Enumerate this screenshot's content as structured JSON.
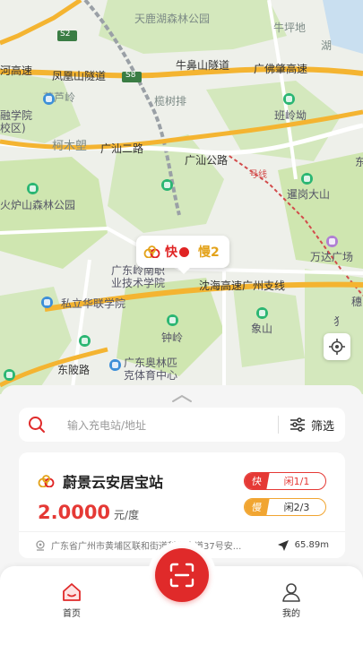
{
  "map": {
    "labels": {
      "park_top": "天鹿湖森林公园",
      "niupingdi": "牛坪地",
      "hu": "湖",
      "s2": "S2",
      "s8": "S8",
      "he_gaosu": "河高速",
      "fengfengshan": "凤凰山隧道",
      "niubishan": "牛鼻山隧道",
      "guangfozhao": "广佛肇高速",
      "huluyan": "葫芦岭",
      "rong_xueyuan": "融学院",
      "xiaoqu": "校区)",
      "mushuping": "榄树排",
      "banling": "班岭坳",
      "kemushi": "柯木塱",
      "guangshan2": "广汕二路",
      "guangshan": "广汕公路",
      "hao_xian": "号线",
      "yuan_east": "东",
      "huolushan": "火炉山森林公园",
      "xianggang": "暹岗大山",
      "wanda": "万达广场",
      "guangdong_lingnan": "广东岭南职",
      "ye_jishu": "业技术学院",
      "shenhai": "沈海高速广州支线",
      "sili_huakuang": "私立华联学院",
      "zhongling": "钟岭",
      "xiangshan": "象山",
      "dongling_lu": "东陂路",
      "guangdong_aoti": "广东奥林匹",
      "keti_center": "克体育中心",
      "sui": "穗",
      "sui2": "犭"
    },
    "marker": {
      "fast": "快",
      "slow": "慢2"
    }
  },
  "search": {
    "placeholder": "输入充电站/地址",
    "filter_label": "筛选"
  },
  "station": {
    "name": "蔚景云安居宝站",
    "price": "2.0000",
    "price_unit": "元/度",
    "fast_tag": "快",
    "fast_idle": "闲1/1",
    "slow_tag": "慢",
    "slow_idle": "闲2/3",
    "address": "广东省广州市黄埔区联和街道科学大道37号安...",
    "distance": "65.89m"
  },
  "nav": {
    "home": "首页",
    "mine": "我的"
  },
  "colors": {
    "accent": "#e02a2a",
    "slow": "#f1a531",
    "map_green": "#cfe6b0"
  }
}
